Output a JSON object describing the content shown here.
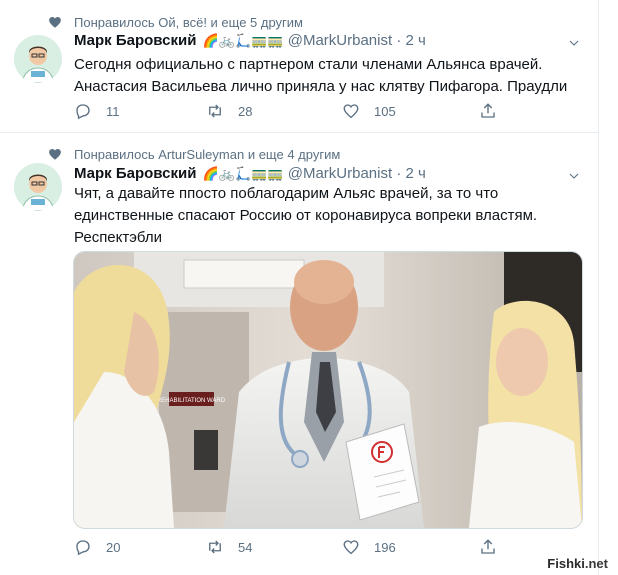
{
  "tweets": [
    {
      "social_context": "Понравилось Ой, всё! и еще 5 другим",
      "author_name": "Марк Баровский",
      "author_emoji": "🌈🚲🛴🚃🚃",
      "handle": "@MarkUrbanist",
      "time": "· 2 ч",
      "text": "Сегодня официально с партнером стали членами Альянса врачей. Анастасия Васильева лично приняла у нас клятву Пифагора. Праудли",
      "replies": "11",
      "retweets": "28",
      "likes": "105"
    },
    {
      "social_context": "Понравилось ArturSuleyman и еще 4 другим",
      "author_name": "Марк Баровский",
      "author_emoji": "🌈🚲🛴🚃🚃",
      "handle": "@MarkUrbanist",
      "time": "· 2 ч",
      "text": "Чят, а давайте ппосто поблагодарим Альяс врачей, за то что единственные спасают Россию от коронавируса вопреки властям. Респектэбли",
      "photo_sign": "REHABILITATION WARD",
      "replies": "20",
      "retweets": "54",
      "likes": "196"
    }
  ],
  "watermark": {
    "brand": "Fishki",
    "tld": ".net"
  },
  "colors": {
    "secondary_text": "#5b7083",
    "border": "#e6ecf0",
    "brand": "#1da1f2"
  }
}
